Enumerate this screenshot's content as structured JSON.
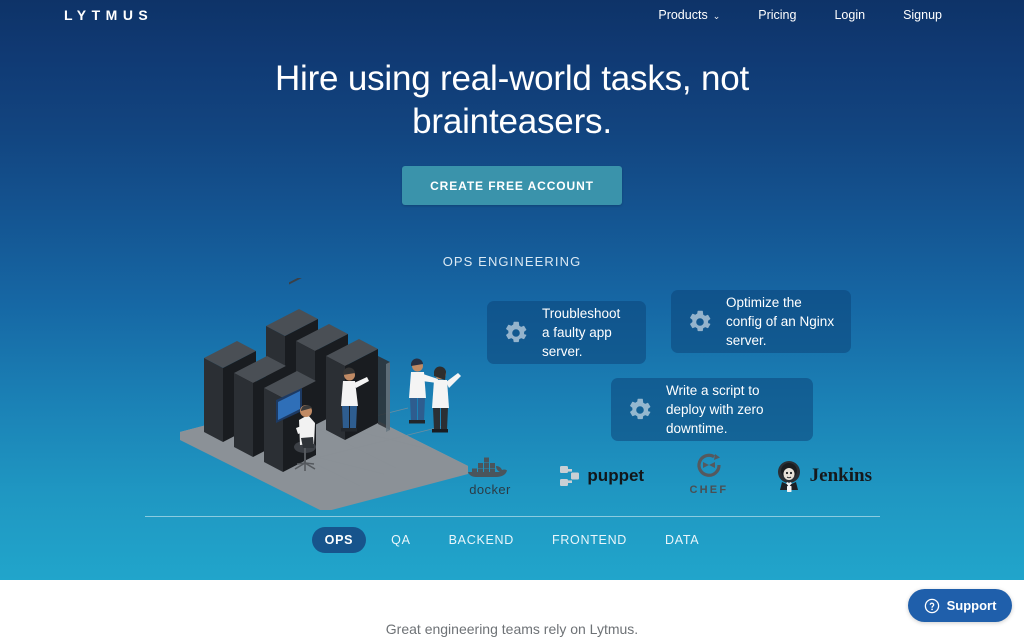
{
  "brand": {
    "logo_text": "LYTMUS"
  },
  "nav": {
    "items": [
      {
        "label": "Products",
        "has_caret": true,
        "caret": "⌄"
      },
      {
        "label": "Pricing",
        "has_caret": false
      },
      {
        "label": "Login",
        "has_caret": false
      },
      {
        "label": "Signup",
        "has_caret": false
      }
    ]
  },
  "hero": {
    "headline": "Hire using real-world tasks, not brainteasers.",
    "cta_label": "CREATE FREE ACCOUNT",
    "cta_color": "#3a93ab",
    "section_label": "OPS ENGINEERING",
    "background_top_color": "#0e3368",
    "background_bottom_color": "#21a5cb"
  },
  "illustration": {
    "name": "isometric-datacenter",
    "description": "Isometric data center with server racks, gray tiled floor and three technicians in lab coats"
  },
  "cards": [
    {
      "icon": "gear-icon",
      "text": "Troubleshoot a faulty app server."
    },
    {
      "icon": "gear-icon",
      "text": "Optimize the config of an Nginx server."
    },
    {
      "icon": "gear-icon",
      "text": "Write a script to deploy with zero downtime."
    }
  ],
  "tech_logos": [
    {
      "name": "docker",
      "label": "docker"
    },
    {
      "name": "puppet",
      "label": "puppet"
    },
    {
      "name": "chef",
      "label": "CHEF"
    },
    {
      "name": "jenkins",
      "label": "Jenkins"
    }
  ],
  "tabs": {
    "items": [
      {
        "label": "OPS",
        "active": true
      },
      {
        "label": "QA",
        "active": false
      },
      {
        "label": "BACKEND",
        "active": false
      },
      {
        "label": "FRONTEND",
        "active": false
      },
      {
        "label": "DATA",
        "active": false
      }
    ],
    "active_color": "#17548c"
  },
  "footer": {
    "tagline": "Great engineering teams rely on Lytmus."
  },
  "support": {
    "label": "Support",
    "icon": "question-circle-icon",
    "color": "#1f5fab"
  }
}
